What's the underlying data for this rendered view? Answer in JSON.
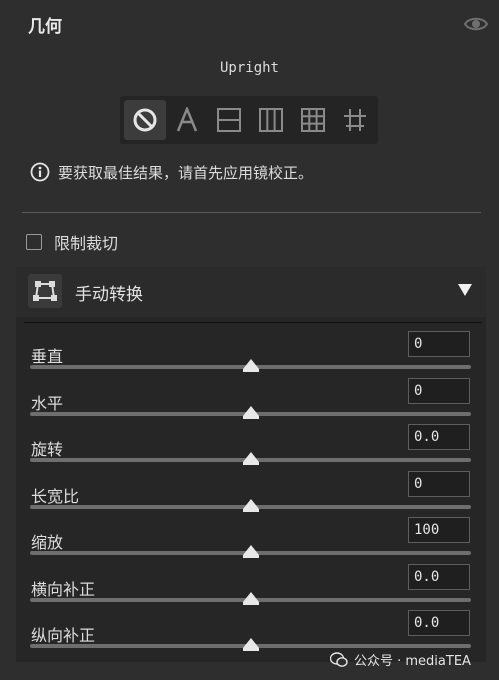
{
  "panel": {
    "title": "几何"
  },
  "upright": {
    "label": "Upright",
    "options": [
      "off",
      "auto",
      "level",
      "vertical",
      "full",
      "guided"
    ],
    "selected": "off"
  },
  "info": {
    "text": "要获取最佳结果，请首先应用镜校正。"
  },
  "constrain_crop": {
    "label": "限制裁切",
    "checked": false
  },
  "transform": {
    "title": "手动转换",
    "sliders": [
      {
        "label": "垂直",
        "value": "0",
        "fraction": 0.5
      },
      {
        "label": "水平",
        "value": "0",
        "fraction": 0.5
      },
      {
        "label": "旋转",
        "value": "0.0",
        "fraction": 0.5
      },
      {
        "label": "长宽比",
        "value": "0",
        "fraction": 0.5
      },
      {
        "label": "缩放",
        "value": "100",
        "fraction": 0.5
      },
      {
        "label": "横向补正",
        "value": "0.0",
        "fraction": 0.5
      },
      {
        "label": "纵向补正",
        "value": "0.0",
        "fraction": 0.5
      }
    ]
  },
  "watermark": {
    "text": "公众号 · mediaTEA"
  },
  "colors": {
    "background": "#2e2e2e",
    "subpanel": "#262626",
    "text": "#dcdcdc",
    "icon": "#9a9a9a"
  }
}
